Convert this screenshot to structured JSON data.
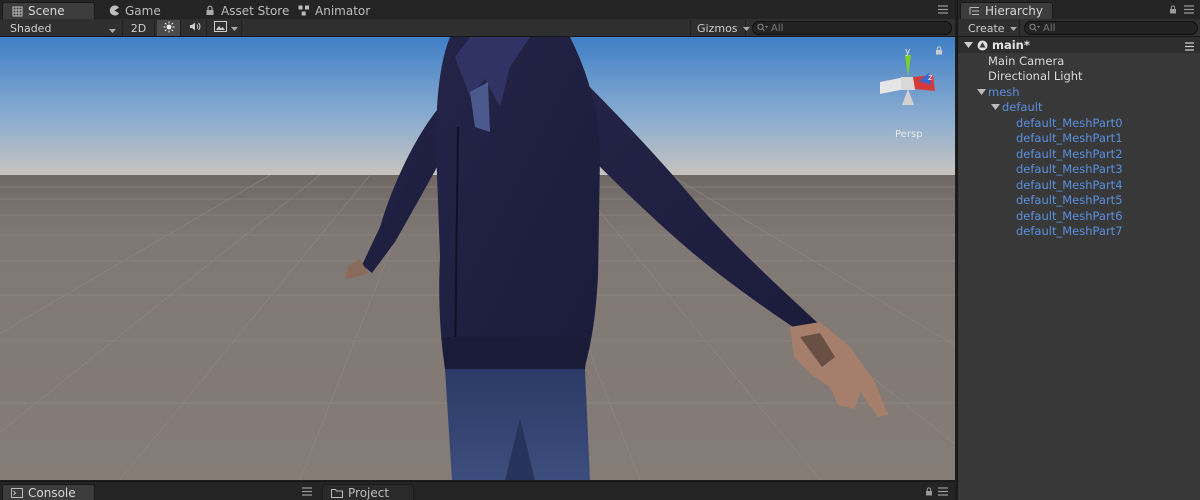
{
  "scene_tabs": [
    {
      "label": "Scene",
      "icon": "scene-grid-icon",
      "active": true
    },
    {
      "label": "Game",
      "icon": "pacman-icon",
      "active": false
    },
    {
      "label": "Asset Store",
      "icon": "lock-icon",
      "active": false
    },
    {
      "label": "Animator",
      "icon": "animator-icon",
      "active": false
    }
  ],
  "scene_toolbar": {
    "draw_mode": "Shaded",
    "mode_2d": "2D",
    "gizmos": "Gizmos",
    "search_placeholder": "All"
  },
  "viewport": {
    "projection_label": "Persp",
    "axis_y": "y",
    "axis_z": "z",
    "sky_top": "#3f7fc6",
    "sky_horizon": "#c9c4bd",
    "ground": "#837a74"
  },
  "hierarchy": {
    "tab_label": "Hierarchy",
    "create_label": "Create",
    "search_placeholder": "All",
    "scene_name": "main*",
    "items": [
      {
        "label": "Main Camera",
        "depth": 1,
        "color": "white",
        "expanded": null
      },
      {
        "label": "Directional Light",
        "depth": 1,
        "color": "white",
        "expanded": null
      },
      {
        "label": "mesh",
        "depth": 1,
        "color": "blue",
        "expanded": true
      },
      {
        "label": "default",
        "depth": 2,
        "color": "blue",
        "expanded": true
      },
      {
        "label": "default_MeshPart0",
        "depth": 3,
        "color": "blue",
        "expanded": null
      },
      {
        "label": "default_MeshPart1",
        "depth": 3,
        "color": "blue",
        "expanded": null
      },
      {
        "label": "default_MeshPart2",
        "depth": 3,
        "color": "blue",
        "expanded": null
      },
      {
        "label": "default_MeshPart3",
        "depth": 3,
        "color": "blue",
        "expanded": null
      },
      {
        "label": "default_MeshPart4",
        "depth": 3,
        "color": "blue",
        "expanded": null
      },
      {
        "label": "default_MeshPart5",
        "depth": 3,
        "color": "blue",
        "expanded": null
      },
      {
        "label": "default_MeshPart6",
        "depth": 3,
        "color": "blue",
        "expanded": null
      },
      {
        "label": "default_MeshPart7",
        "depth": 3,
        "color": "blue",
        "expanded": null
      }
    ]
  },
  "bottom_tabs": [
    {
      "label": "Console",
      "icon": "console-icon",
      "active": true
    },
    {
      "label": "Project",
      "icon": "folder-icon",
      "active": false
    }
  ]
}
